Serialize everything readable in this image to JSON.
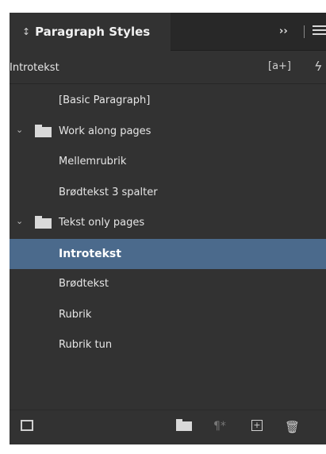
{
  "panel": {
    "tab_title": "Paragraph Styles",
    "tab_arrows": "↕",
    "collapse_label": "››"
  },
  "current_style": {
    "name": "Introtekst",
    "new_from_icon_label": "[a+]",
    "quick_apply_label": "ϟ"
  },
  "styles": [
    {
      "label": "[Basic Paragraph]",
      "type": "style",
      "indent": 1
    },
    {
      "label": "Work along pages",
      "type": "group",
      "expanded": true
    },
    {
      "label": "Mellemrubrik",
      "type": "style",
      "indent": 1
    },
    {
      "label": "Brødtekst 3 spalter",
      "type": "style",
      "indent": 1
    },
    {
      "label": "Tekst only pages",
      "type": "group",
      "expanded": true
    },
    {
      "label": "Introtekst",
      "type": "style",
      "indent": 1,
      "selected": true
    },
    {
      "label": "Brødtekst",
      "type": "style",
      "indent": 1
    },
    {
      "label": "Rubrik",
      "type": "style",
      "indent": 1
    },
    {
      "label": "Rubrik tun",
      "type": "style",
      "indent": 1
    }
  ],
  "bottom_icons": {
    "load": "load-styles-icon",
    "folder": "new-style-group-icon",
    "clear": "clear-overrides-icon",
    "new": "create-new-style-icon",
    "trash": "delete-style-icon"
  },
  "colors": {
    "panel_bg": "#323232",
    "selected_bg": "#4b6a8c"
  }
}
